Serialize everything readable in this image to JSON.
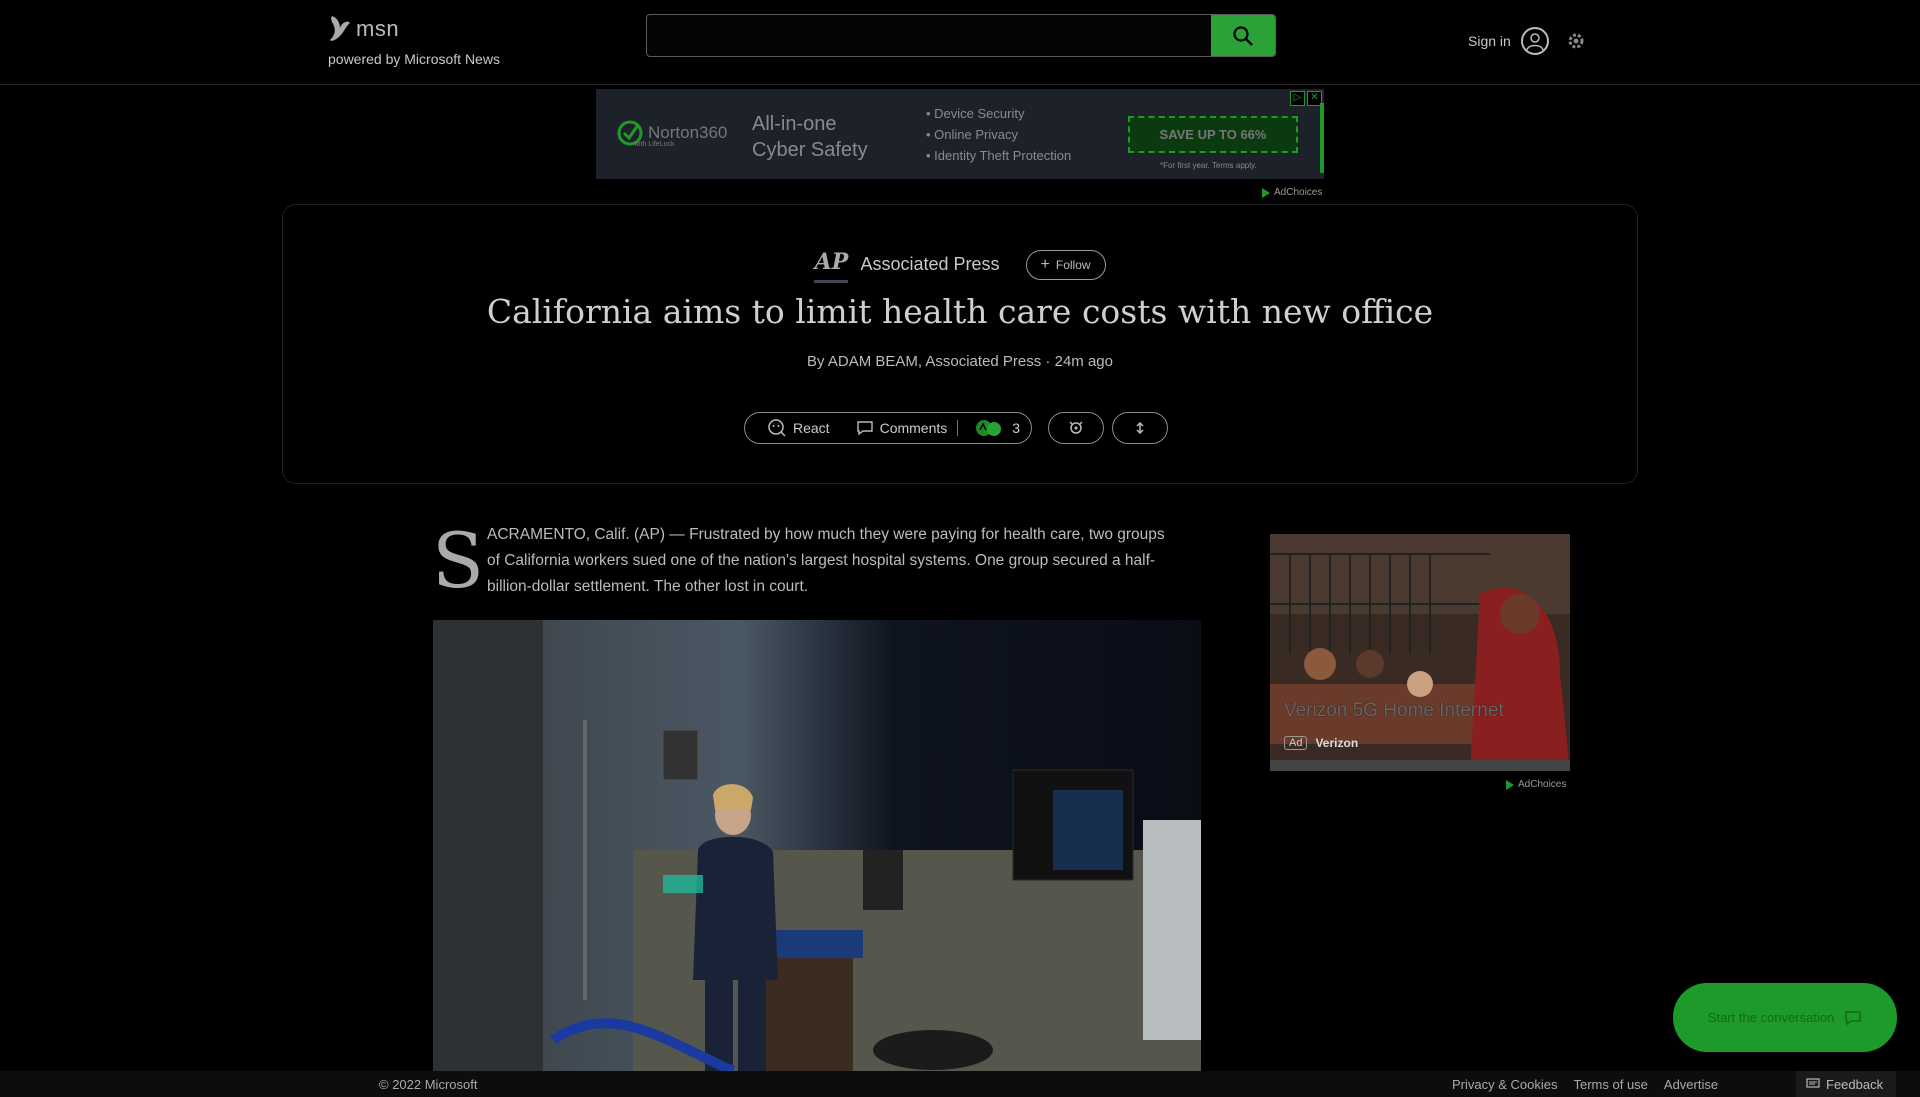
{
  "header": {
    "logo_text": "msn",
    "logo_subtitle": "powered by Microsoft News",
    "search_value": "",
    "sign_in_label": "Sign in"
  },
  "ad_top": {
    "brand": "Norton360",
    "brand_sub": "with LifeLock",
    "headline_line1": "All-in-one",
    "headline_line2": "Cyber Safety",
    "bullets": [
      "• Device Security",
      "• Online Privacy",
      "• Identity Theft Protection"
    ],
    "cta": "SAVE UP TO 66%",
    "fine_print": "*For first year. Terms apply.",
    "adchoices": "AdChoices"
  },
  "article": {
    "source_logo": "AP",
    "source_name": "Associated Press",
    "follow_label": "Follow",
    "headline": "California aims to limit health care costs with new office",
    "byline": "By ADAM BEAM, Associated Press · 24m ago",
    "react_label": "React",
    "comments_label": "Comments",
    "reaction_count": "3",
    "dropcap": "S",
    "lede": "ACRAMENTO, Calif. (AP) — Frustrated by how much they were paying for health care, two groups of California workers sued one of the nation's largest hospital systems. One group secured a half-billion-dollar settlement. The other lost in court."
  },
  "ad_side": {
    "title": "Verizon 5G Home Internet",
    "badge": "Ad",
    "advertiser": "Verizon",
    "adchoices": "AdChoices"
  },
  "conversation_button": "Start the conversation",
  "footer": {
    "copyright": "© 2022 Microsoft",
    "links": [
      "Privacy & Cookies",
      "Terms of use",
      "Advertise"
    ],
    "feedback": "Feedback"
  },
  "colors": {
    "accent_green": "#2ba238",
    "background": "#000000"
  }
}
